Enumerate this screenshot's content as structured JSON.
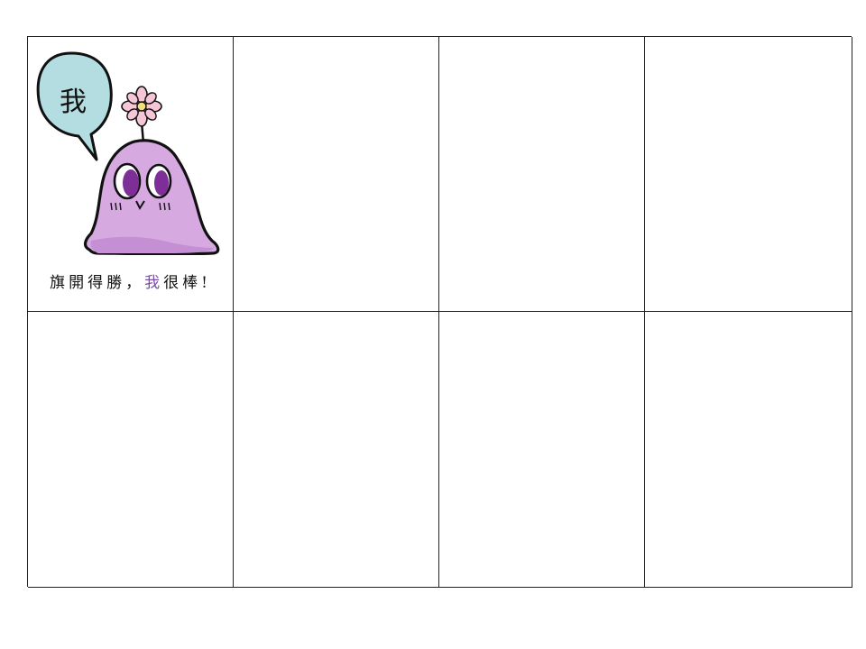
{
  "cards": [
    {
      "bubble_text": "我",
      "caption_before": "旗開得勝，",
      "caption_highlight": "我",
      "caption_after": "很棒!"
    }
  ],
  "colors": {
    "bubble": "#b3dde0",
    "blob": "#d6a9e0",
    "blob_shadow": "#c58fd3",
    "eyes": "#7d2f97",
    "petal": "#f6c6d6",
    "flower_center": "#f2e07a",
    "highlight_text": "#7b4fa8"
  },
  "icons": [
    "speech-bubble-icon",
    "blob-mascot-icon",
    "flower-icon"
  ]
}
